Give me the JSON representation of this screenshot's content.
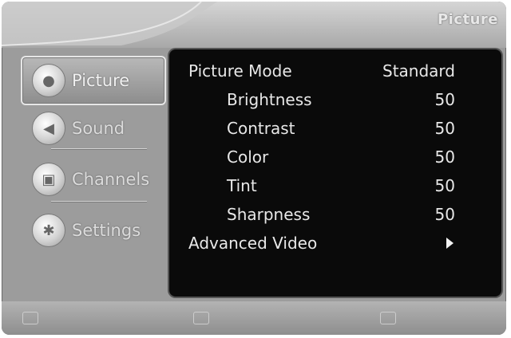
{
  "header": {
    "title": "Picture"
  },
  "sidebar": {
    "items": [
      {
        "label": "Picture",
        "icon": "picture-icon",
        "active": true
      },
      {
        "label": "Sound",
        "icon": "sound-icon",
        "active": false
      },
      {
        "label": "Channels",
        "icon": "channels-icon",
        "active": false
      },
      {
        "label": "Settings",
        "icon": "settings-icon",
        "active": false
      }
    ]
  },
  "menu": {
    "rows": [
      {
        "label": "Picture Mode",
        "value": "Standard"
      },
      {
        "label": "Brightness",
        "value": "50"
      },
      {
        "label": "Contrast",
        "value": "50"
      },
      {
        "label": "Color",
        "value": "50"
      },
      {
        "label": "Tint",
        "value": "50"
      },
      {
        "label": "Sharpness",
        "value": "50"
      },
      {
        "label": "Advanced Video",
        "value": ""
      }
    ]
  }
}
